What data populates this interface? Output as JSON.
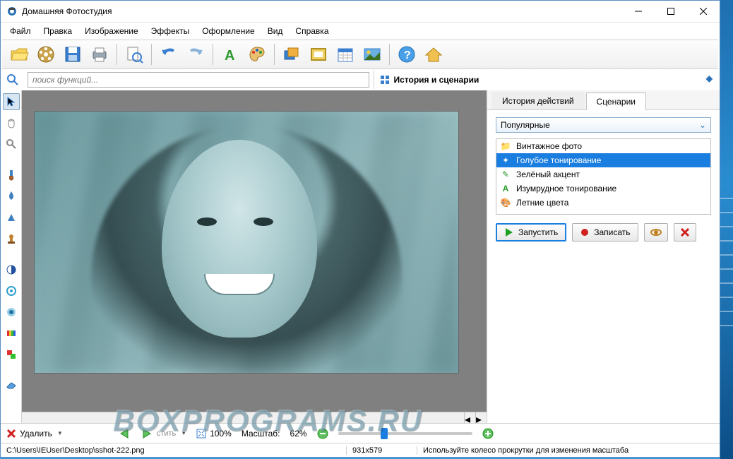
{
  "window": {
    "title": "Домашняя Фотостудия"
  },
  "menu": [
    "Файл",
    "Правка",
    "Изображение",
    "Эффекты",
    "Оформление",
    "Вид",
    "Справка"
  ],
  "search": {
    "placeholder": "поиск функций..."
  },
  "panel": {
    "title": "История и сценарии",
    "tabs": {
      "history": "История действий",
      "scenarios": "Сценарии"
    },
    "dropdown": "Популярные",
    "scenarios": [
      "Винтажное фото",
      "Голубое тонирование",
      "Зелёный акцент",
      "Изумрудное тонирование",
      "Летние цвета"
    ],
    "run": "Запустить",
    "record": "Записать"
  },
  "bottom": {
    "delete": "Удалить",
    "fit": "100%",
    "scale_label": "Масштаб:",
    "scale_val": "62%"
  },
  "status": {
    "path": "C:\\Users\\IEUser\\Desktop\\sshot-222.png",
    "dims": "931x579",
    "hint": "Используйте колесо прокрутки для изменения масштаба"
  },
  "watermark": "BOXPROGRAMS.RU"
}
